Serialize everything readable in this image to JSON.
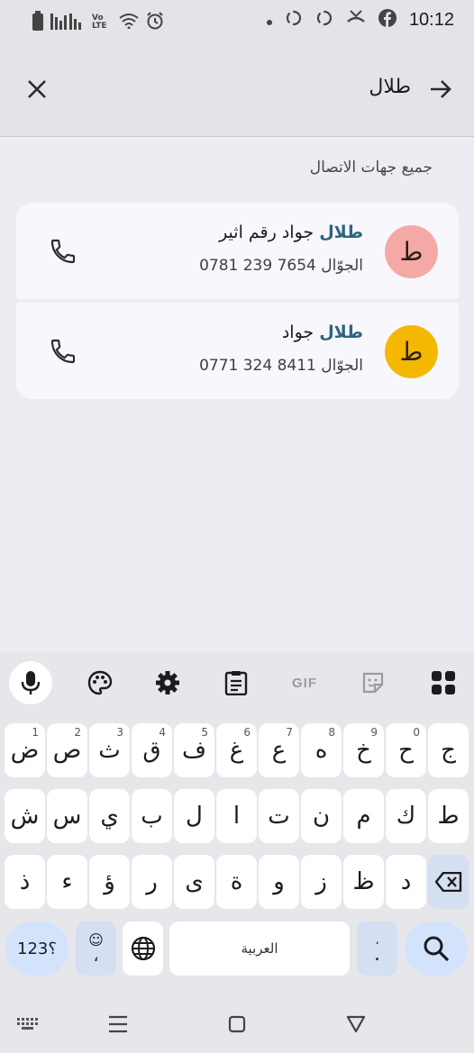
{
  "status_bar": {
    "time": "10:12",
    "left_icons": [
      "battery-icon",
      "signal-icon",
      "volte-icon",
      "wifi-icon",
      "alarm-icon"
    ],
    "right_icons": [
      "notification-dot-icon",
      "sync-icon",
      "sync-icon",
      "missed-call-icon",
      "facebook-icon"
    ],
    "volte_label": "Vo LTE"
  },
  "search": {
    "query": "طلال",
    "close_icon": "close-icon",
    "back_icon": "arrow-right-icon"
  },
  "section_header": "جميع جهات الاتصال",
  "contacts": [
    {
      "avatar_letter": "ط",
      "avatar_color": "#f4a9a4",
      "name_highlight": "طلال",
      "name_rest": " جواد رقم اثير",
      "phone_type": "الجوّال",
      "phone_number": "0781 239 7654"
    },
    {
      "avatar_letter": "ط",
      "avatar_color": "#f5b800",
      "name_highlight": "طلال",
      "name_rest": " جواد",
      "phone_type": "الجوّال",
      "phone_number": "0771 324 8411"
    }
  ],
  "keyboard": {
    "toolbar": [
      "mic-icon",
      "palette-icon",
      "gear-icon",
      "clipboard-icon",
      "gif-icon",
      "sticker-icon",
      "grid-icon"
    ],
    "gif_label": "GIF",
    "row1": [
      {
        "char": "ض",
        "hint": "1"
      },
      {
        "char": "ص",
        "hint": "2"
      },
      {
        "char": "ث",
        "hint": "3"
      },
      {
        "char": "ق",
        "hint": "4"
      },
      {
        "char": "ف",
        "hint": "5"
      },
      {
        "char": "غ",
        "hint": "6"
      },
      {
        "char": "ع",
        "hint": "7"
      },
      {
        "char": "ه",
        "hint": "8"
      },
      {
        "char": "خ",
        "hint": "9"
      },
      {
        "char": "ح",
        "hint": "0"
      },
      {
        "char": "ج",
        "hint": ""
      }
    ],
    "row2": [
      "ش",
      "س",
      "ي",
      "ب",
      "ل",
      "ا",
      "ت",
      "ن",
      "م",
      "ك",
      "ط"
    ],
    "row3": [
      "ذ",
      "ء",
      "ؤ",
      "ر",
      "ى",
      "ة",
      "و",
      "ز",
      "ظ",
      "د"
    ],
    "symbols_label": "؟123",
    "emoji_comma": "،",
    "space_label": "العربية",
    "period_label": ".",
    "period_hint": "،"
  },
  "nav": [
    "keyboard-hide-icon",
    "menu-icon",
    "home-square-icon",
    "back-triangle-icon"
  ]
}
